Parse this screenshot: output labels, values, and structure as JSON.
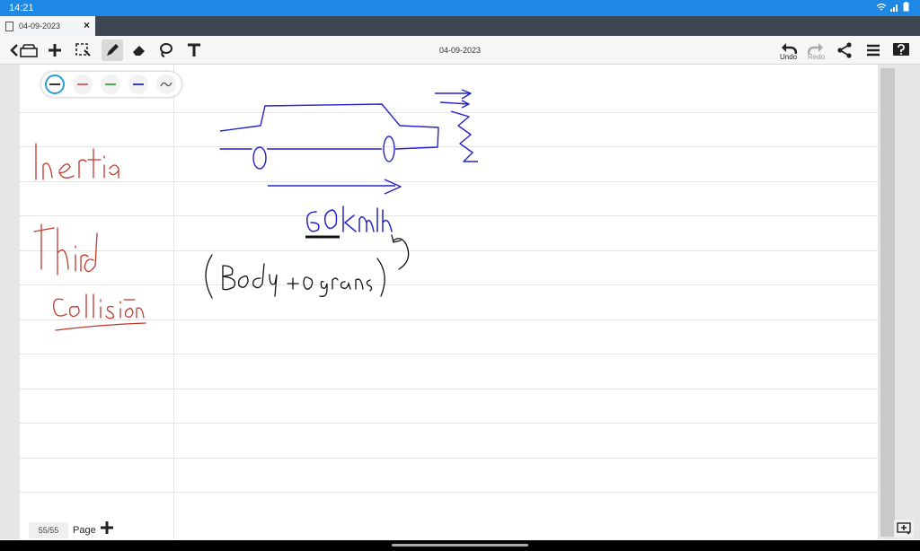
{
  "status": {
    "time": "14:21"
  },
  "tab": {
    "title": "04-09-2023"
  },
  "toolbar": {
    "doc_title": "04-09-2023",
    "undo_label": "Undo",
    "redo_label": "Redo"
  },
  "pens": [
    {
      "color": "#333333"
    },
    {
      "color": "#d46a6a"
    },
    {
      "color": "#4caf50"
    },
    {
      "color": "#3b3bc9"
    },
    {
      "color": "#555555"
    }
  ],
  "ink": {
    "red_notes": [
      "Inertia",
      "Third",
      "Collision"
    ],
    "blue_notes": [
      "60kmlh"
    ],
    "black_notes": [
      "(Body + Organs)"
    ]
  },
  "footer": {
    "page_count": "55/55",
    "page_label": "Page"
  },
  "colors": {
    "accent": "#1e88e5",
    "tabbar": "#3d4550",
    "ink_blue": "#2424c8",
    "ink_red": "#c0392b"
  }
}
